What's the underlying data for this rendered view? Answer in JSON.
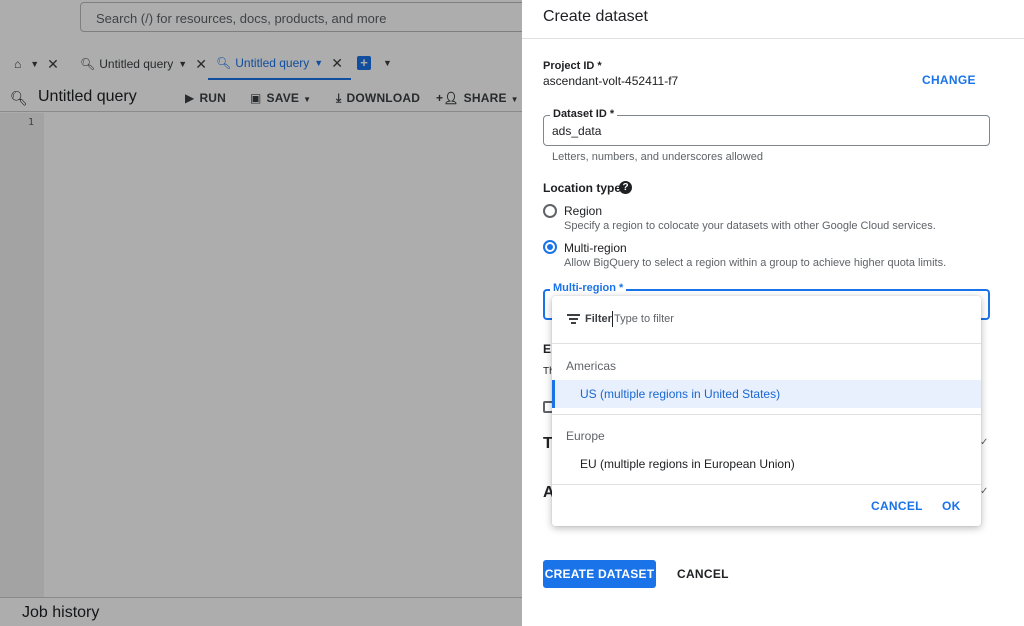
{
  "console": {
    "search_placeholder": "Search (/) for resources, docs, products, and more",
    "tabs": [
      {
        "label": "Untitled query",
        "active": false
      },
      {
        "label": "Untitled query",
        "active": true
      }
    ],
    "query_title": "Untitled query",
    "toolbar": {
      "run": "RUN",
      "save": "SAVE",
      "download": "DOWNLOAD",
      "share": "SHARE"
    },
    "editor_line_number": "1",
    "job_history": "Job history"
  },
  "panel": {
    "title": "Create dataset",
    "project_id_label": "Project ID *",
    "project_id_value": "ascendant-volt-452411-f7",
    "change_button": "CHANGE",
    "dataset_id_label": "Dataset ID *",
    "dataset_id_value": "ads_data",
    "dataset_id_hint": "Letters, numbers, and underscores allowed",
    "location_type_label": "Location type",
    "options": [
      {
        "label": "Region",
        "description": "Specify a region to colocate your datasets with other Google Cloud services.",
        "selected": false
      },
      {
        "label": "Multi-region",
        "description": "Allow BigQuery to select a region within a group to achieve higher quota limits.",
        "selected": true
      }
    ],
    "multi_region_label": "Multi-region *",
    "peek": {
      "e": "E",
      "t": "Th",
      "T": "T",
      "A": "A"
    },
    "create_button": "CREATE DATASET",
    "cancel_button": "CANCEL"
  },
  "dropdown": {
    "filter_label": "Filter",
    "filter_placeholder": "Type to filter",
    "groups": [
      {
        "header": "Americas",
        "items": [
          {
            "label": "US (multiple regions in United States)",
            "selected": true
          }
        ]
      },
      {
        "header": "Europe",
        "items": [
          {
            "label": "EU (multiple regions in European Union)",
            "selected": false
          }
        ]
      }
    ],
    "cancel": "CANCEL",
    "ok": "OK"
  },
  "colors": {
    "accent": "#1a73e8",
    "selected_bg": "#e8f0fe",
    "scrim": "rgba(0,0,0,0.32)"
  }
}
